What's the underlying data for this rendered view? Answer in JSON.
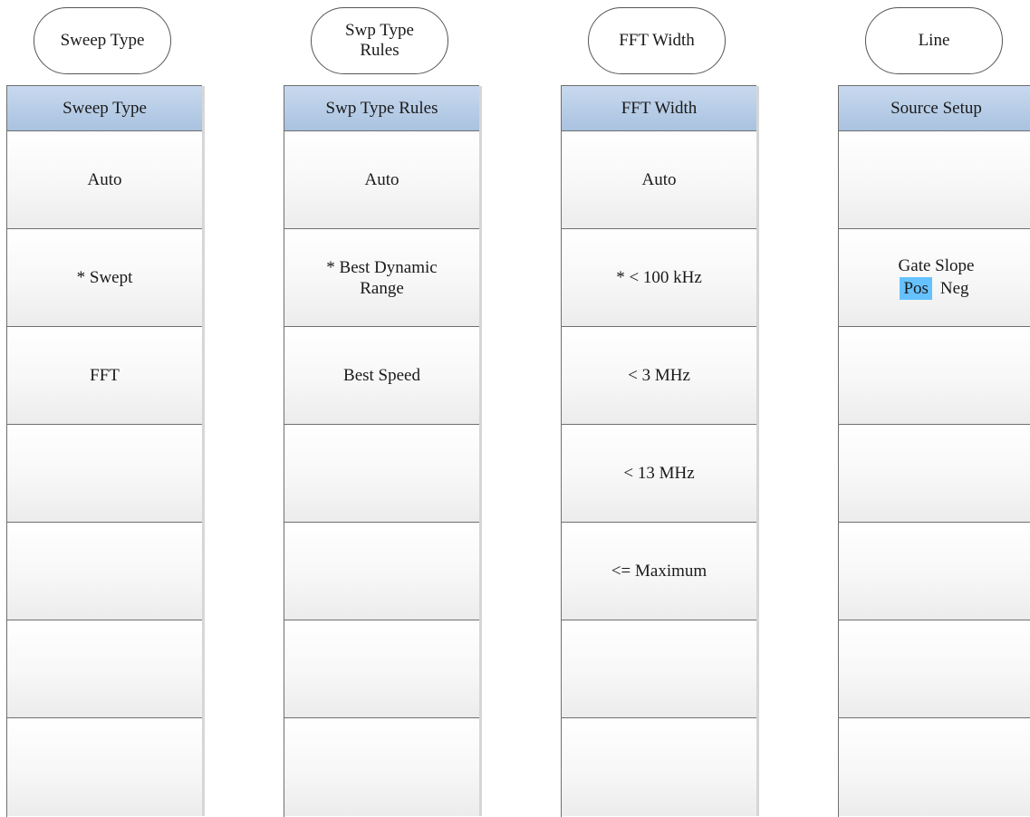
{
  "pills": [
    {
      "label": "Sweep Type"
    },
    {
      "label": "Swp Type\nRules"
    },
    {
      "label": "FFT Width"
    },
    {
      "label": "Line"
    }
  ],
  "menus": [
    {
      "header": "Sweep Type",
      "items": [
        {
          "label": "Auto"
        },
        {
          "label": "* Swept"
        },
        {
          "label": "FFT"
        },
        {
          "label": ""
        },
        {
          "label": ""
        },
        {
          "label": ""
        },
        {
          "label": ""
        }
      ]
    },
    {
      "header": "Swp Type Rules",
      "items": [
        {
          "label": "Auto"
        },
        {
          "label": "* Best Dynamic\nRange"
        },
        {
          "label": "Best Speed"
        },
        {
          "label": ""
        },
        {
          "label": ""
        },
        {
          "label": ""
        },
        {
          "label": ""
        }
      ]
    },
    {
      "header": "FFT Width",
      "items": [
        {
          "label": "Auto"
        },
        {
          "label": "* < 100 kHz"
        },
        {
          "label": "< 3 MHz"
        },
        {
          "label": "< 13 MHz"
        },
        {
          "label": "<= Maximum"
        },
        {
          "label": ""
        },
        {
          "label": ""
        }
      ]
    },
    {
      "header": "Source Setup",
      "items": [
        {
          "label": ""
        },
        {
          "label": "Gate Slope",
          "options": [
            "Pos",
            "Neg"
          ],
          "selected": "Pos"
        },
        {
          "label": ""
        },
        {
          "label": ""
        },
        {
          "label": ""
        },
        {
          "label": ""
        },
        {
          "label": ""
        }
      ]
    }
  ],
  "colors": {
    "header_gradient_top": "#c8d9ee",
    "header_gradient_bottom": "#a9c2e0",
    "selected_option": "#66c2ff",
    "border": "#6f6f6f"
  }
}
